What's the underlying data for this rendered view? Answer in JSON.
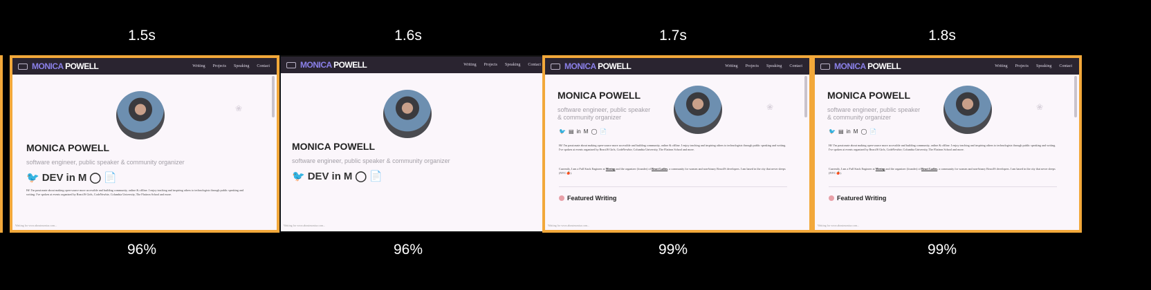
{
  "frames": [
    {
      "time": "1.5s",
      "percent": "96%"
    },
    {
      "time": "1.6s",
      "percent": "96%"
    },
    {
      "time": "1.7s",
      "percent": "99%"
    },
    {
      "time": "1.8s",
      "percent": "99%"
    }
  ],
  "site": {
    "logo_first": "MONICA",
    "logo_second": "POWELL",
    "nav_links": [
      "Writing",
      "Projects",
      "Speaking",
      "Contact"
    ],
    "name": "MONICA POWELL",
    "subtitle_one_line": "software engineer, public speaker & community organizer",
    "subtitle_line1": "software engineer, public speaker",
    "subtitle_line2": "& community organizer",
    "social_big": [
      "🐦",
      "DEV",
      "in",
      "M",
      "◯",
      "📄"
    ],
    "social_small": [
      "🐦",
      "▤",
      "in",
      "M",
      "◯",
      "📄"
    ],
    "bio_intro": "Hi! I'm passionate about making open-source more accessible and building community, online & offline. I enjoy teaching and inspiring others to technologists through public speaking and writing. I've spoken at events organized by ReactJS Girls, CodeNewbie, Columbia University, The Flatiron School and more.",
    "bio_current_prefix": "Currently, I am a Full Stack Engineer at",
    "bio_company": "Meetup",
    "bio_middle": "and the organizer (founder) of",
    "bio_org": "React Ladies",
    "bio_current_suffix": ", a community for women and non-binary ReactJS developers. I am based in the city that never sleeps (NYC 🍎).",
    "featured_writing": "Featured Writing",
    "footer": "Waiting for www.aboutmonica.com..."
  }
}
